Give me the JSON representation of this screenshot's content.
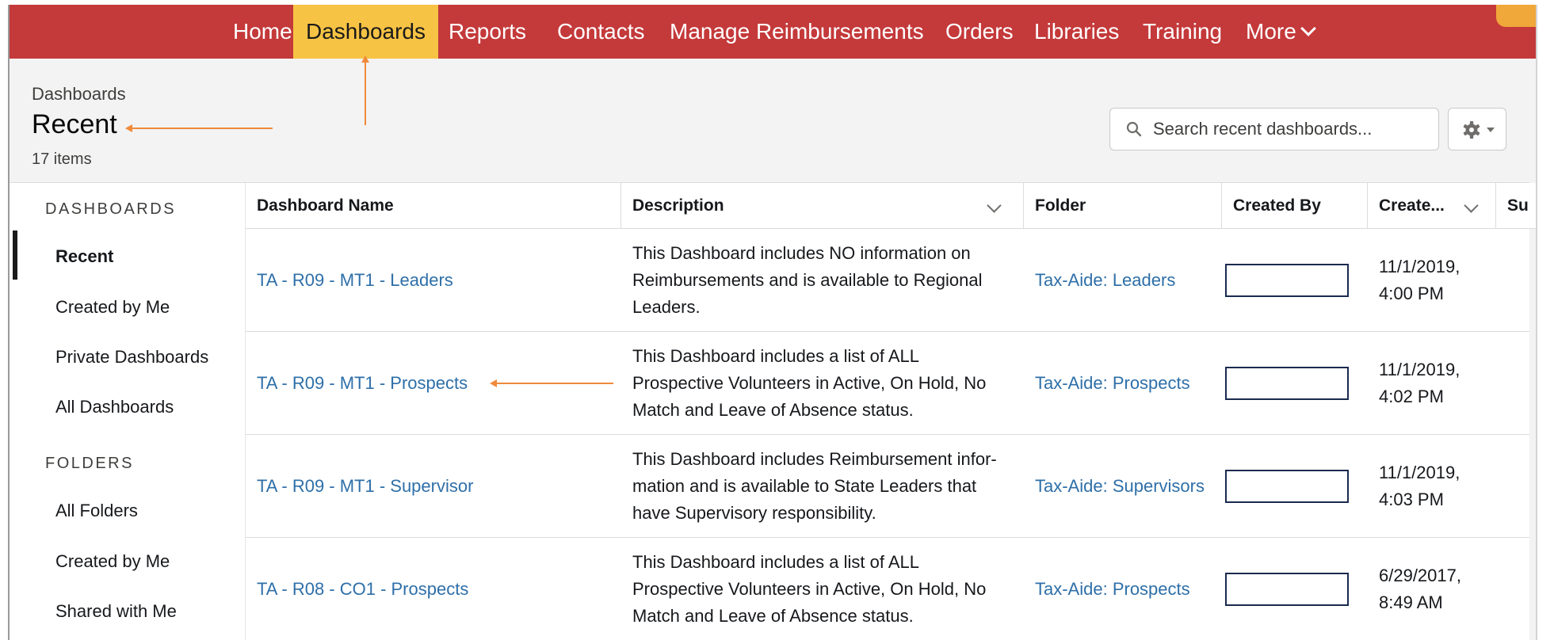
{
  "nav": {
    "items": [
      "Home",
      "Dashboards",
      "Reports",
      "Contacts",
      "Manage Reimbursements",
      "Orders",
      "Libraries",
      "Training",
      "More"
    ],
    "active": "Dashboards"
  },
  "header": {
    "breadcrumb": "Dashboards",
    "title": "Recent",
    "count": "17 items"
  },
  "search": {
    "placeholder": "Search recent dashboards..."
  },
  "sidebar": {
    "dashboards_heading": "DASHBOARDS",
    "dashboard_items": [
      "Recent",
      "Created by Me",
      "Private Dashboards",
      "All Dashboards"
    ],
    "folders_heading": "FOLDERS",
    "folder_items": [
      "All Folders",
      "Created by Me",
      "Shared with Me"
    ]
  },
  "table": {
    "columns": [
      "Dashboard Name",
      "Description",
      "Folder",
      "Created By",
      "Create...",
      "Su"
    ],
    "rows": [
      {
        "name": "TA - R09 - MT1 - Leaders",
        "description": [
          "This Dashboard includes NO information on",
          "Reimbursements and is available to Regional",
          "Leaders."
        ],
        "folder": "Tax-Aide: Leaders",
        "created": [
          "11/1/2019,",
          "4:00 PM"
        ]
      },
      {
        "name": "TA - R09 - MT1 - Prospects",
        "description": [
          "This Dashboard includes a list of ALL",
          "Prospective Volunteers in Active, On Hold, No",
          "Match and Leave of Absence status."
        ],
        "folder": "Tax-Aide: Prospects",
        "created": [
          "11/1/2019,",
          "4:02 PM"
        ]
      },
      {
        "name": "TA - R09 - MT1 - Supervisor",
        "description": [
          "This Dashboard includes Reimbursement infor-",
          "mation and is available to State Leaders that",
          "have Supervisory responsibility."
        ],
        "folder": "Tax-Aide: Supervisors",
        "created": [
          "11/1/2019,",
          "4:03 PM"
        ]
      },
      {
        "name": "TA - R08 - CO1 - Prospects",
        "description": [
          "This Dashboard includes a list of ALL",
          "Prospective Volunteers in Active, On Hold, No",
          "Match and Leave of Absence status."
        ],
        "folder": "Tax-Aide: Prospects",
        "created": [
          "6/29/2017,",
          "8:49 AM"
        ]
      }
    ]
  },
  "icons": {
    "search": "search-icon",
    "settings": "gear-icon",
    "more": "chevron-down-icon"
  },
  "colors": {
    "navbar": "#c4393a",
    "active_tab": "#f7c344",
    "link": "#2e6fa8",
    "annotation_arrow": "#f08a3b"
  }
}
